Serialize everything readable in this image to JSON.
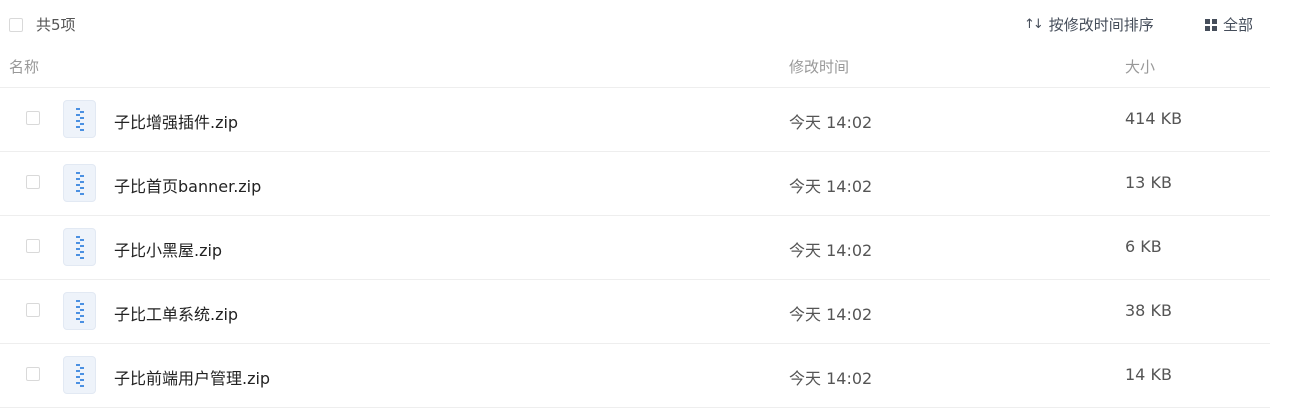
{
  "toolbar": {
    "count_label": "共5项",
    "sort_icon": "sort-arrows-icon",
    "sort_label": "按修改时间排序",
    "view_icon": "grid-icon",
    "view_label": "全部"
  },
  "columns": {
    "name": "名称",
    "modified": "修改时间",
    "size": "大小"
  },
  "files": [
    {
      "name": "子比增强插件.zip",
      "modified": "今天 14:02",
      "size": "414 KB",
      "icon": "zip-file-icon"
    },
    {
      "name": "子比首页banner.zip",
      "modified": "今天 14:02",
      "size": "13 KB",
      "icon": "zip-file-icon"
    },
    {
      "name": "子比小黑屋.zip",
      "modified": "今天 14:02",
      "size": "6 KB",
      "icon": "zip-file-icon"
    },
    {
      "name": "子比工单系统.zip",
      "modified": "今天 14:02",
      "size": "38 KB",
      "icon": "zip-file-icon"
    },
    {
      "name": "子比前端用户管理.zip",
      "modified": "今天 14:02",
      "size": "14 KB",
      "icon": "zip-file-icon"
    }
  ],
  "colors": {
    "zip_icon_stripe": "#4a90e2",
    "zip_icon_bg": "#eef3fa",
    "divider": "#eeeeee"
  }
}
